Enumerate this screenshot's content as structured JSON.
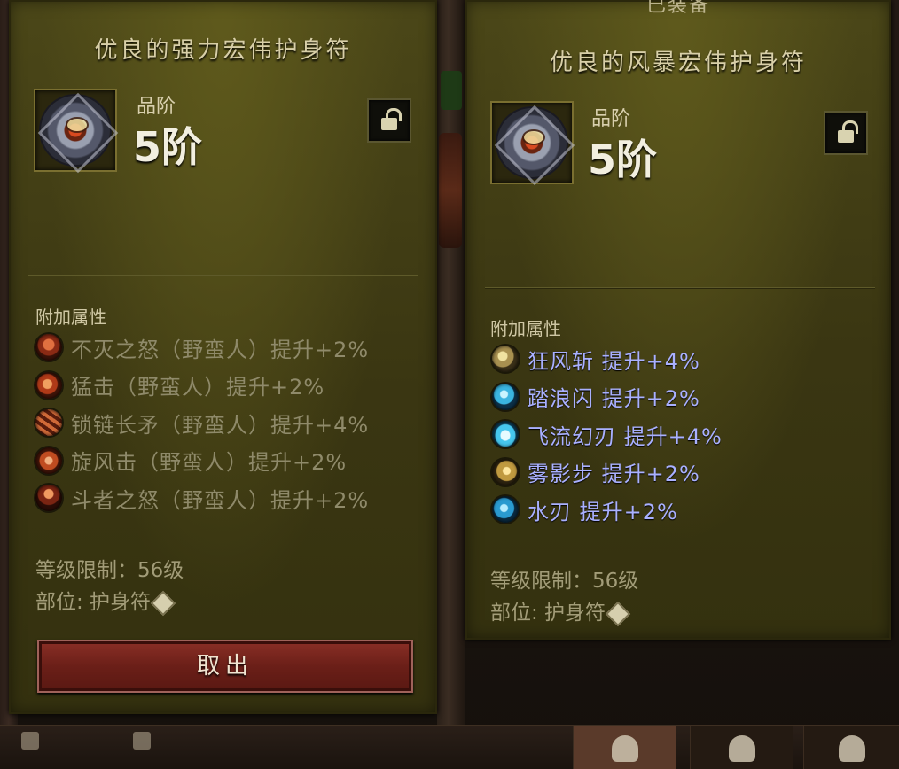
{
  "left_panel": {
    "title": "优良的强力宏伟护身符",
    "grade_label": "品阶",
    "grade_value": "5阶",
    "section_title": "附加属性",
    "attributes": [
      {
        "text": "不灭之怒（野蛮人）提升+2%",
        "icon": "undying-rage-icon"
      },
      {
        "text": "猛击（野蛮人）提升+2%",
        "icon": "bash-icon"
      },
      {
        "text": "锁链长矛（野蛮人）提升+4%",
        "icon": "chain-spear-icon"
      },
      {
        "text": "旋风击（野蛮人）提升+2%",
        "icon": "whirlwind-icon"
      },
      {
        "text": "斗者之怒（野蛮人）提升+2%",
        "icon": "fighters-fury-icon"
      }
    ],
    "level_limit": "等级限制：56级",
    "slot": "部位: 护身符",
    "take_out_button": "取出",
    "attr_color": "#8f8a6a"
  },
  "right_panel": {
    "equipped_label": "已装备",
    "title": "优良的风暴宏伟护身符",
    "grade_label": "品阶",
    "grade_value": "5阶",
    "section_title": "附加属性",
    "attributes": [
      {
        "text": "狂风斩  提升+4%",
        "icon": "gale-slash-icon"
      },
      {
        "text": "踏浪闪  提升+2%",
        "icon": "wave-step-icon"
      },
      {
        "text": "飞流幻刃  提升+4%",
        "icon": "flowing-blade-icon"
      },
      {
        "text": "雾影步  提升+2%",
        "icon": "mist-step-icon"
      },
      {
        "text": "水刃  提升+2%",
        "icon": "water-blade-icon"
      }
    ],
    "level_limit": "等级限制：56级",
    "slot": "部位: 护身符",
    "attr_color": "#a9b0ff"
  },
  "colors": {
    "panel_bg": "#3a3612",
    "title": "#d8cfa8",
    "button_red": "#6b1f18"
  }
}
